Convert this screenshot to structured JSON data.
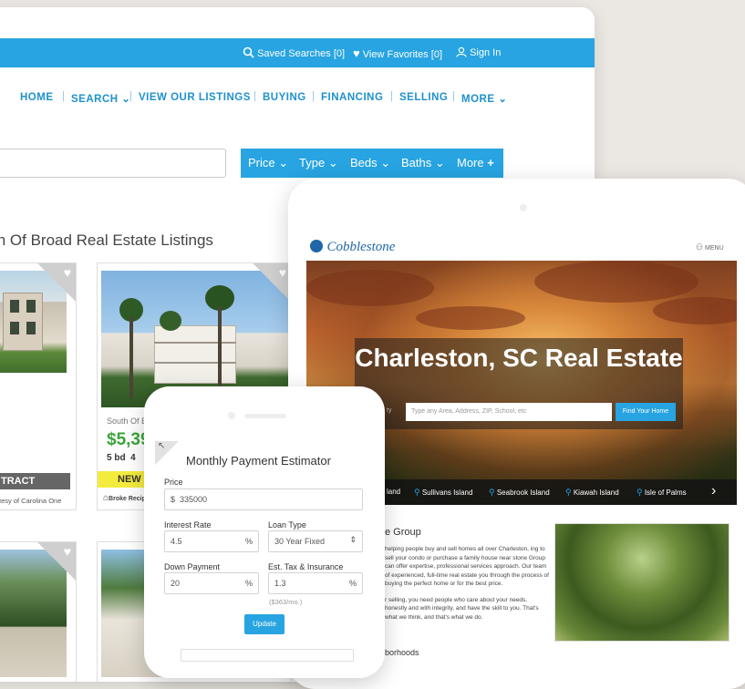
{
  "desktop": {
    "topbar": {
      "saved_searches": "Saved Searches [0]",
      "view_favorites": "View Favorites [0]",
      "sign_in": "Sign In"
    },
    "nav": {
      "home": "HOME",
      "search": "SEARCH",
      "view_listings": "VIEW OUR LISTINGS",
      "buying": "BUYING",
      "financing": "FINANCING",
      "selling": "SELLING",
      "more": "MORE"
    },
    "filters": {
      "price": "Price",
      "type": "Type",
      "beds": "Beds",
      "baths": "Baths",
      "more": "More"
    },
    "listings_title": "th Of Broad Real Estate Listings",
    "card2": {
      "area": "South Of E",
      "price": "$5,39",
      "beds": "5 bd",
      "baths": "4",
      "badge": "NEW"
    },
    "card1": {
      "status": "TRACT",
      "courtesy": "tesy of Carolina One",
      "partial_letter": "s"
    },
    "broker_logo": "Broke Recip"
  },
  "tablet": {
    "logo": "Cobblestone",
    "menu": "MENU",
    "hero_title": "Charleston, SC Real Estate",
    "search_placeholder": "Type any Area, Address, ZIP, School, etc",
    "search_prefix": "ty",
    "find_button": "Find Your Home",
    "islands": [
      "Sullivans Island",
      "Seabrook Island",
      "Kiawah Island",
      "Isle of Palms"
    ],
    "islands_partial": "land",
    "about_title": "e Group",
    "about_text_1": "helping people buy and sell homes all over Charleston, ing to sell your condo or purchase a family house near stone Group can offer expertise, professional services approach. Our team of experienced, full-time real estate you through the process of buying the perfect home or for the best price.",
    "about_text_2": "r selling, you need people who care about your needs, honestly and with integrity, and have the skill to you. That's what we think, and that's what we do.",
    "neighborhoods_partial": "borhoods"
  },
  "phone": {
    "title": "Monthly Payment Estimator",
    "price_label": "Price",
    "price_prefix": "$",
    "price_value": "335000",
    "interest_label": "Interest Rate",
    "interest_value": "4.5",
    "interest_unit": "%",
    "loan_type_label": "Loan Type",
    "loan_type_value": "30 Year Fixed",
    "down_label": "Down Payment",
    "down_value": "20",
    "down_unit": "%",
    "tax_label": "Est. Tax & Insurance",
    "tax_value": "1.3",
    "tax_unit": "%",
    "tax_monthly": "($363/mo.)",
    "update_button": "Update"
  }
}
